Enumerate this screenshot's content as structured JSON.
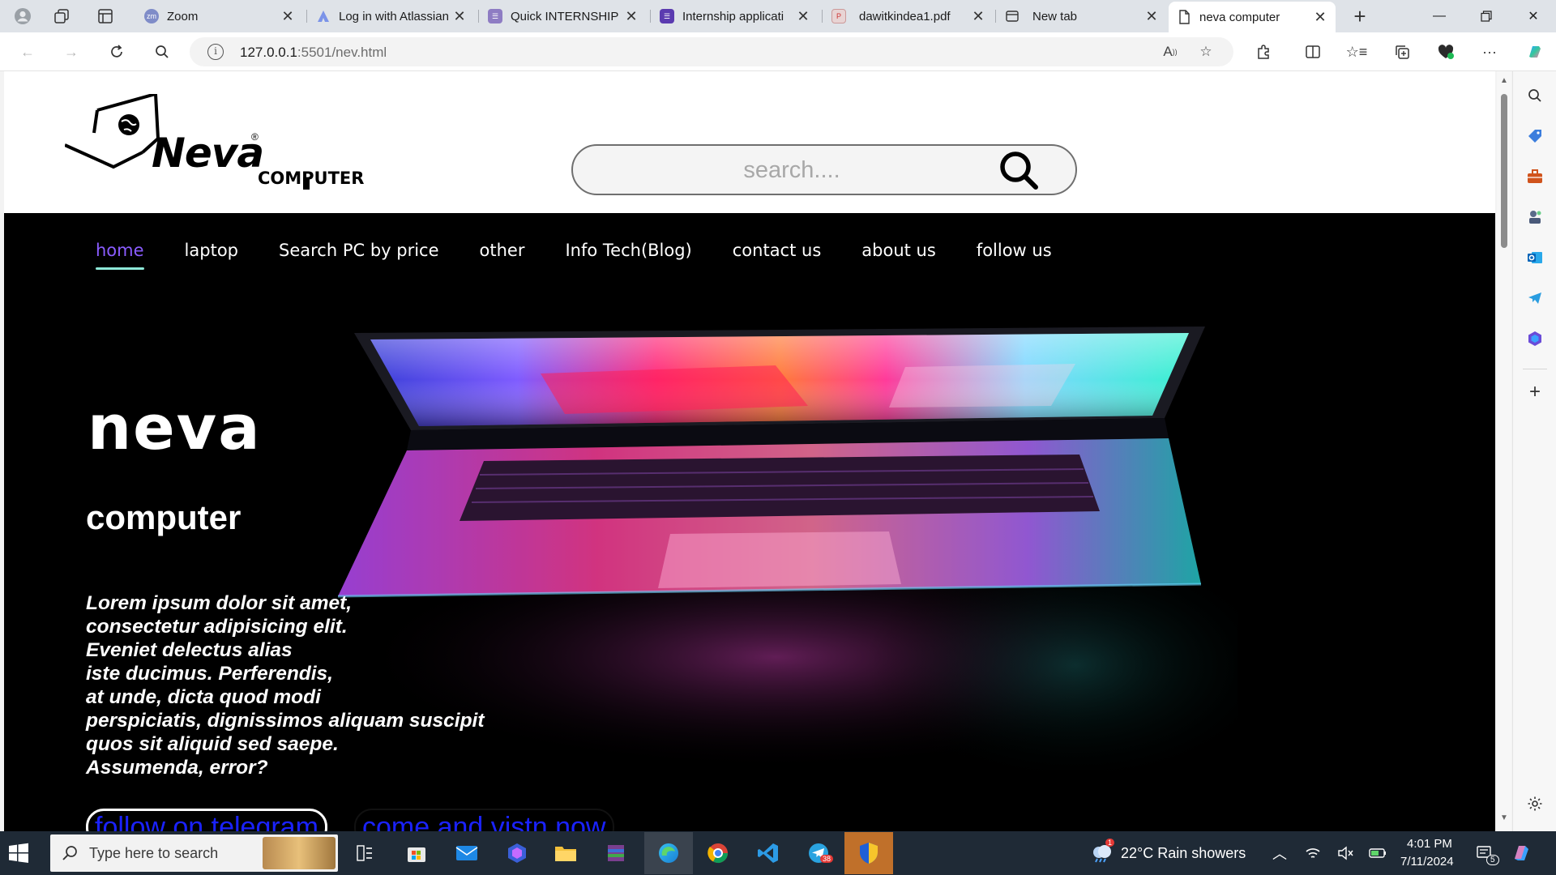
{
  "browser": {
    "tabs": [
      {
        "title": "Zoom",
        "favicon": "zoom-icon",
        "active": false
      },
      {
        "title": "Log in with Atlassian",
        "favicon": "atlassian-icon",
        "active": false
      },
      {
        "title": "Quick INTERNSHIP",
        "favicon": "forms-icon",
        "active": false
      },
      {
        "title": "Internship applicati",
        "favicon": "forms-icon",
        "active": false
      },
      {
        "title": "dawitkindea1.pdf",
        "favicon": "pdf-icon",
        "active": false
      },
      {
        "title": "New tab",
        "favicon": "newtab-icon",
        "active": false
      },
      {
        "title": "neva computer",
        "favicon": "page-icon",
        "active": true
      }
    ],
    "url_host": "127.0.0.1",
    "url_rest": ":5501/nev.html",
    "colors": {
      "tabstrip": "#dfe3e8",
      "toolbar": "#ffffff"
    }
  },
  "site": {
    "logo": {
      "neva": "Neva",
      "registered": "®",
      "computer": "COMPUTER"
    },
    "search": {
      "placeholder": "search...."
    },
    "nav": [
      {
        "label": "home",
        "active": true
      },
      {
        "label": "laptop",
        "active": false
      },
      {
        "label": "Search PC by price",
        "active": false
      },
      {
        "label": "other",
        "active": false
      },
      {
        "label": "Info Tech(Blog)",
        "active": false
      },
      {
        "label": "contact us",
        "active": false
      },
      {
        "label": "about us",
        "active": false
      },
      {
        "label": "follow us",
        "active": false
      }
    ],
    "hero": {
      "title": "neva",
      "subtitle": "computer",
      "lines": [
        "Lorem ipsum dolor sit amet,",
        "consectetur adipisicing elit.",
        "Eveniet delectus alias",
        "iste ducimus. Perferendis,",
        "at unde, dicta quod modi",
        "perspiciatis, dignissimos aliquam suscipit",
        "quos sit aliquid sed saepe.",
        "Assumenda, error?"
      ],
      "button_telegram": "follow on telegram",
      "button_visit": "come and vistn now"
    },
    "colors": {
      "hero_bg": "#000000",
      "nav_active": "#8a5cff",
      "underline": "#8ee8d8",
      "button_text": "#1a22ff"
    }
  },
  "taskbar": {
    "search_placeholder": "Type here to search",
    "weather": "22°C  Rain showers",
    "time": "4:01 PM",
    "date": "7/11/2024",
    "telegram_badge": "38",
    "notification_count": "5",
    "weather_badge": "1"
  }
}
